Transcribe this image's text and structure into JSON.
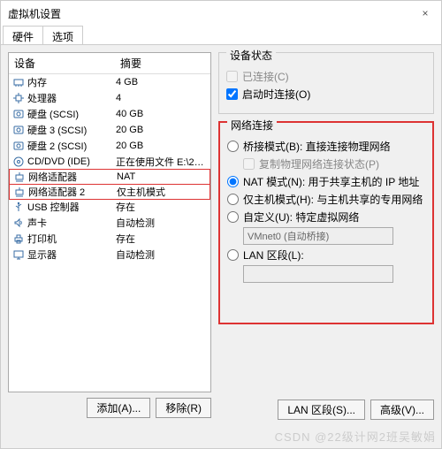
{
  "window": {
    "title": "虚拟机设置"
  },
  "tabs": {
    "hardware": "硬件",
    "options": "选项"
  },
  "deviceList": {
    "headDevice": "设备",
    "headSummary": "摘要",
    "rows": [
      {
        "name": "内存",
        "summary": "4 GB",
        "icon": "memory"
      },
      {
        "name": "处理器",
        "summary": "4",
        "icon": "cpu"
      },
      {
        "name": "硬盘 (SCSI)",
        "summary": "40 GB",
        "icon": "disk"
      },
      {
        "name": "硬盘 3 (SCSI)",
        "summary": "20 GB",
        "icon": "disk"
      },
      {
        "name": "硬盘 2 (SCSI)",
        "summary": "20 GB",
        "icon": "disk"
      },
      {
        "name": "CD/DVD (IDE)",
        "summary": "正在使用文件 E:\\20220308020...",
        "icon": "cd"
      },
      {
        "name": "网络适配器",
        "summary": "NAT",
        "icon": "net"
      },
      {
        "name": "网络适配器 2",
        "summary": "仅主机模式",
        "icon": "net"
      },
      {
        "name": "USB 控制器",
        "summary": "存在",
        "icon": "usb"
      },
      {
        "name": "声卡",
        "summary": "自动检测",
        "icon": "sound"
      },
      {
        "name": "打印机",
        "summary": "存在",
        "icon": "printer"
      },
      {
        "name": "显示器",
        "summary": "自动检测",
        "icon": "display"
      }
    ]
  },
  "buttons": {
    "add": "添加(A)...",
    "remove": "移除(R)",
    "lanSeg": "LAN 区段(S)...",
    "advanced": "高级(V)..."
  },
  "status": {
    "legend": "设备状态",
    "connected": "已连接(C)",
    "connectAtPowerOn": "启动时连接(O)"
  },
  "network": {
    "legend": "网络连接",
    "bridged": "桥接模式(B): 直接连接物理网络",
    "replicate": "复制物理网络连接状态(P)",
    "nat": "NAT 模式(N): 用于共享主机的 IP 地址",
    "hostOnly": "仅主机模式(H): 与主机共享的专用网络",
    "custom": "自定义(U): 特定虚拟网络",
    "customValue": "VMnet0 (自动桥接)",
    "lan": "LAN 区段(L):",
    "lanValue": ""
  },
  "watermark": "CSDN @22级计网2班吴敏娟"
}
